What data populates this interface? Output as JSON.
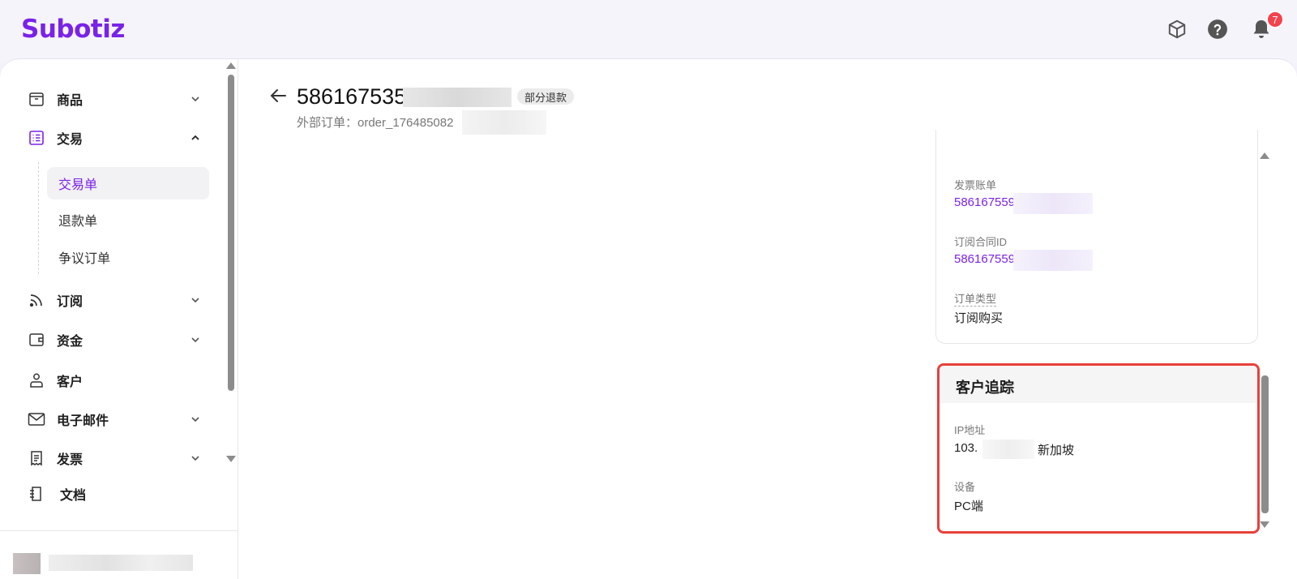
{
  "brand": {
    "name": "Subotiz",
    "color": "#7a22e8"
  },
  "topbar": {
    "icons": [
      "cube-icon",
      "help-icon",
      "bell-icon"
    ],
    "notification_count": "7"
  },
  "sidebar": {
    "items": [
      {
        "label": "商品",
        "icon": "box-icon",
        "expandable": true
      },
      {
        "label": "交易",
        "icon": "list-icon",
        "expandable": true,
        "expanded": true
      },
      {
        "label": "订阅",
        "icon": "rss-icon",
        "expandable": true
      },
      {
        "label": "资金",
        "icon": "wallet-icon",
        "expandable": true
      },
      {
        "label": "客户",
        "icon": "user-icon",
        "expandable": false
      },
      {
        "label": "电子邮件",
        "icon": "mail-icon",
        "expandable": true
      },
      {
        "label": "发票",
        "icon": "invoice-icon",
        "expandable": true
      },
      {
        "label": "文档",
        "icon": "doc-icon",
        "expandable": false
      }
    ],
    "transaction_subitems": [
      {
        "label": "交易单",
        "selected": true
      },
      {
        "label": "退款单",
        "selected": false
      },
      {
        "label": "争议订单",
        "selected": false
      }
    ]
  },
  "order": {
    "title": "586167535",
    "status": "部分退款",
    "external_order": "外部订单：order_176485082"
  },
  "details": {
    "invoice_label": "发票账单",
    "invoice_value": "586167559",
    "contract_label": "订阅合同ID",
    "contract_value": "586167559",
    "order_type_label": "订单类型",
    "order_type_value": "订阅购买"
  },
  "tracking": {
    "title": "客户追踪",
    "ip_label": "IP地址",
    "ip_prefix": "103.",
    "ip_location": "新加坡",
    "device_label": "设备",
    "device_value": "PC端"
  },
  "colors": {
    "highlight_border": "#e8403b",
    "link": "#7a22e8",
    "badge": "#f5424d"
  }
}
